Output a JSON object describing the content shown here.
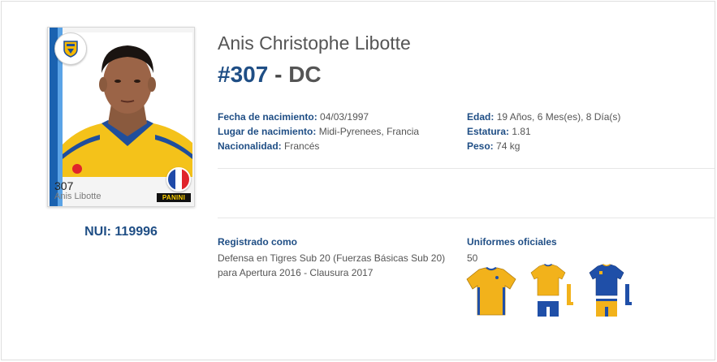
{
  "card": {
    "number": "307",
    "name": "Anis Libotte",
    "brand": "PANINI",
    "flag_colors": [
      "#1f4aa8",
      "#ffffff",
      "#e0242b"
    ],
    "club_colors": [
      "#1f4e9c",
      "#f5b800"
    ]
  },
  "nui": "NUI: 119996",
  "player": {
    "full_name": "Anis Christophe Libotte",
    "number": "#307",
    "separator": "-",
    "position": "DC"
  },
  "facts_left": [
    {
      "label": "Fecha de nacimiento:",
      "value": "04/03/1997"
    },
    {
      "label": "Lugar de nacimiento:",
      "value": "Midi-Pyrenees, Francia"
    },
    {
      "label": "Nacionalidad:",
      "value": "Francés"
    }
  ],
  "facts_right": [
    {
      "label": "Edad:",
      "value": "19 Años, 6 Mes(es), 8 Día(s)"
    },
    {
      "label": "Estatura:",
      "value": "1.81"
    },
    {
      "label": "Peso:",
      "value": "74 kg"
    }
  ],
  "registration": {
    "title": "Registrado como",
    "text": "Defensa en Tigres Sub 20 (Fuerzas Básicas Sub 20) para Apertura 2016 - Clausura 2017"
  },
  "uniforms": {
    "title": "Uniformes oficiales",
    "count": "50"
  },
  "colors": {
    "accent": "#1f4e85",
    "gold": "#f2b21b",
    "blue": "#1f4fa8"
  }
}
